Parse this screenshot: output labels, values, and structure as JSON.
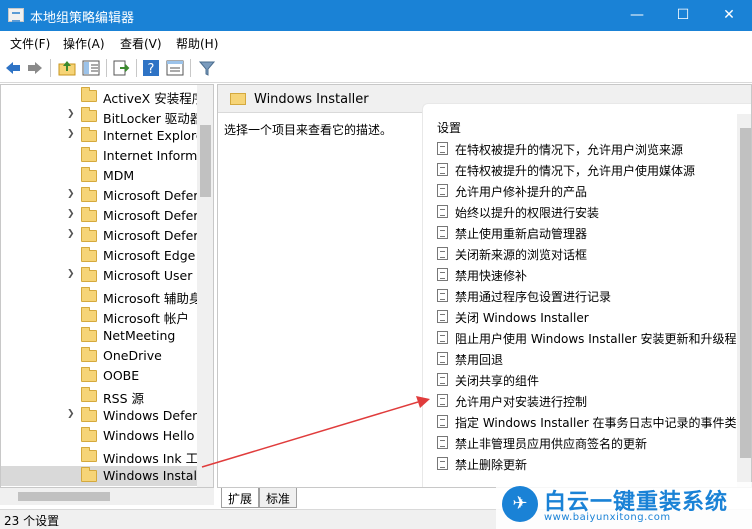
{
  "window": {
    "title": "本地组策略编辑器",
    "minimize": "—",
    "maximize": "☐",
    "close": "✕"
  },
  "menu": [
    "文件(F)",
    "操作(A)",
    "查看(V)",
    "帮助(H)"
  ],
  "tree": {
    "items": [
      {
        "label": "ActiveX 安装程序",
        "expandable": false
      },
      {
        "label": "BitLocker 驱动器",
        "expandable": true
      },
      {
        "label": "Internet Explore",
        "expandable": true
      },
      {
        "label": "Internet Informa",
        "expandable": false
      },
      {
        "label": "MDM",
        "expandable": false
      },
      {
        "label": "Microsoft Defer",
        "expandable": true
      },
      {
        "label": "Microsoft Defer",
        "expandable": true
      },
      {
        "label": "Microsoft Defer",
        "expandable": true
      },
      {
        "label": "Microsoft Edge",
        "expandable": false
      },
      {
        "label": "Microsoft User",
        "expandable": true
      },
      {
        "label": "Microsoft 辅助身",
        "expandable": false
      },
      {
        "label": "Microsoft 帐户",
        "expandable": false
      },
      {
        "label": "NetMeeting",
        "expandable": false
      },
      {
        "label": "OneDrive",
        "expandable": false
      },
      {
        "label": "OOBE",
        "expandable": false
      },
      {
        "label": "RSS 源",
        "expandable": false
      },
      {
        "label": "Windows Defen",
        "expandable": true
      },
      {
        "label": "Windows Hello",
        "expandable": false
      },
      {
        "label": "Windows Ink 工",
        "expandable": false
      },
      {
        "label": "Windows Instal",
        "expandable": false,
        "selected": true
      }
    ]
  },
  "right": {
    "header_title": "Windows Installer",
    "description": "选择一个项目来查看它的描述。",
    "column_header": "设置",
    "settings": [
      "在特权被提升的情况下，允许用户浏览来源",
      "在特权被提升的情况下，允许用户使用媒体源",
      "允许用户修补提升的产品",
      "始终以提升的权限进行安装",
      "禁止使用重新启动管理器",
      "关闭新来源的浏览对话框",
      "禁用快速修补",
      "禁用通过程序包设置进行记录",
      "关闭 Windows Installer",
      "阻止用户使用 Windows Installer 安装更新和升级程",
      "禁用回退",
      "关闭共享的组件",
      "允许用户对安装进行控制",
      "指定 Windows Installer 在事务日志中记录的事件类",
      "禁止非管理员应用供应商签名的更新",
      "禁止删除更新"
    ]
  },
  "tabs": [
    "扩展",
    "标准"
  ],
  "status": "23 个设置",
  "watermark": {
    "title": "白云一键重装系统",
    "url": "www.baiyunxitong.com"
  },
  "colors": {
    "titlebar": "#1a82d6",
    "arrow": "#e03c3c"
  }
}
